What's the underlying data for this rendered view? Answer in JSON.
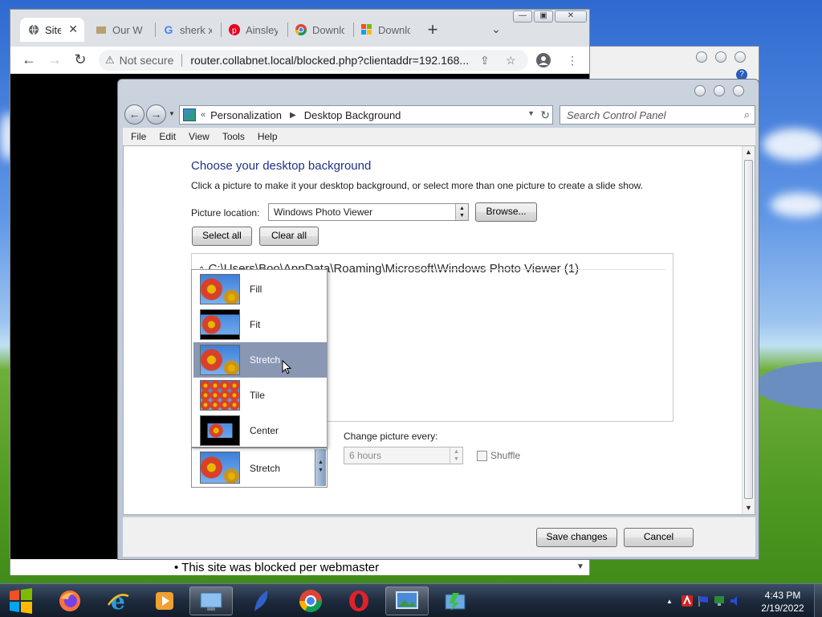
{
  "chrome": {
    "tabs": [
      {
        "label": "Site",
        "icon": "globe-icon"
      },
      {
        "label": "Our W",
        "icon": "moose-icon"
      },
      {
        "label": "sherk x",
        "icon": "google-icon"
      },
      {
        "label": "Ainsley",
        "icon": "pinterest-icon"
      },
      {
        "label": "Downlo",
        "icon": "chrome-icon"
      },
      {
        "label": "Downlo",
        "icon": "microsoft-icon"
      }
    ],
    "not_secure": "Not secure",
    "url": "router.collabnet.local/blocked.php?clientaddr=192.168...",
    "blocked_message": "This site was blocked per webmaster"
  },
  "control_panel": {
    "breadcrumb": [
      "Personalization",
      "Desktop Background"
    ],
    "search_placeholder": "Search Control Panel",
    "menu": [
      "File",
      "Edit",
      "View",
      "Tools",
      "Help"
    ],
    "heading": "Choose your desktop background",
    "subtext": "Click a picture to make it your desktop background, or select more than one picture to create a slide show.",
    "picture_location_label": "Picture location:",
    "picture_location_value": "Windows Photo Viewer",
    "browse_label": "Browse...",
    "select_all_label": "Select all",
    "clear_all_label": "Clear all",
    "picture_group": "C:\\Users\\Boo\\AppData\\Roaming\\Microsoft\\Windows Photo Viewer (1)",
    "position_options": [
      {
        "label": "Fill",
        "selected": false
      },
      {
        "label": "Fit",
        "selected": false
      },
      {
        "label": "Stretch",
        "selected": true
      },
      {
        "label": "Tile",
        "selected": false
      },
      {
        "label": "Center",
        "selected": false
      }
    ],
    "position_current": "Stretch",
    "change_every_label": "Change picture every:",
    "change_every_value": "6 hours",
    "shuffle_label": "Shuffle",
    "save_label": "Save changes",
    "cancel_label": "Cancel"
  },
  "taskbar": {
    "apps": [
      "firefox-icon",
      "internet-explorer-icon",
      "media-player-icon",
      "control-panel-icon",
      "feather-icon",
      "chrome-icon",
      "opera-icon",
      "photo-viewer-icon",
      "update-icon"
    ],
    "time": "4:43 PM",
    "date": "2/19/2022"
  }
}
